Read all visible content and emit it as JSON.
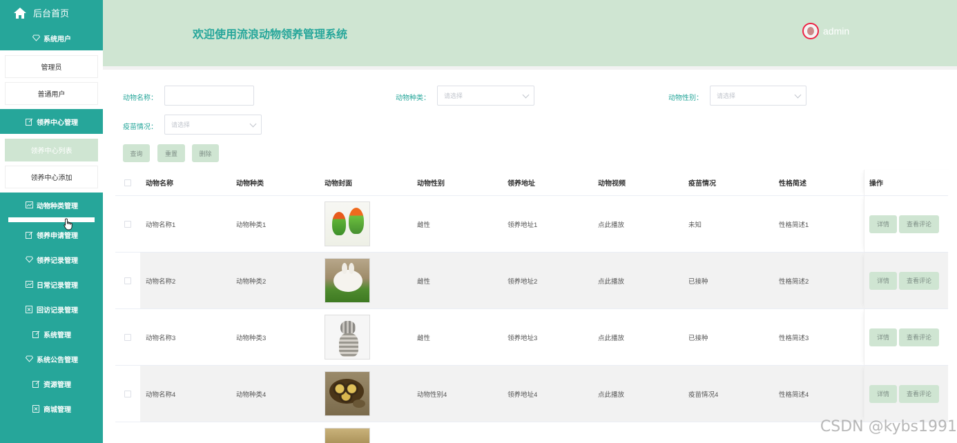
{
  "sidebar": {
    "home": "后台首页",
    "menus": [
      {
        "title": "系统用户",
        "icon": "diamond-icon",
        "subs": [
          "管理员",
          "普通用户"
        ]
      },
      {
        "title": "领养中心管理",
        "icon": "edit-icon",
        "subs": [
          "领养中心列表",
          "领养中心添加"
        ],
        "active_sub": 0
      },
      {
        "title": "动物种类管理",
        "icon": "chart-icon"
      },
      {
        "title": "领养申请管理",
        "icon": "edit-icon"
      },
      {
        "title": "领养记录管理",
        "icon": "diamond-icon"
      },
      {
        "title": "日常记录管理",
        "icon": "chart-icon"
      },
      {
        "title": "回访记录管理",
        "icon": "close-box-icon"
      },
      {
        "title": "系统管理",
        "icon": "edit-icon"
      },
      {
        "title": "系统公告管理",
        "icon": "diamond-icon"
      },
      {
        "title": "资源管理",
        "icon": "edit-icon"
      },
      {
        "title": "商城管理",
        "icon": "close-box-icon"
      }
    ]
  },
  "header": {
    "title": "欢迎使用流浪动物领养管理系统",
    "user": "admin"
  },
  "filters": {
    "name_label": "动物名称：",
    "type_label": "动物种类：",
    "type_placeholder": "请选择",
    "sex_label": "动物性别：",
    "sex_placeholder": "请选择",
    "vaccine_label": "疫苗情况：",
    "vaccine_placeholder": "请选择",
    "buttons": {
      "query": "查询",
      "reset": "重置",
      "delete": "删除"
    }
  },
  "table": {
    "columns": [
      "动物名称",
      "动物种类",
      "动物封面",
      "动物性别",
      "领养地址",
      "动物视频",
      "疫苗情况",
      "性格简述",
      "操作"
    ],
    "rows": [
      {
        "name": "动物名称1",
        "type": "动物种类1",
        "image": "parrot",
        "sex": "雌性",
        "address": "领养地址1",
        "video": "点此播放",
        "vaccine": "未知",
        "desc": "性格简述1"
      },
      {
        "name": "动物名称2",
        "type": "动物种类2",
        "image": "rabbit",
        "sex": "雌性",
        "address": "领养地址2",
        "video": "点此播放",
        "vaccine": "已接种",
        "desc": "性格简述2"
      },
      {
        "name": "动物名称3",
        "type": "动物种类3",
        "image": "cat",
        "sex": "雌性",
        "address": "领养地址3",
        "video": "点此播放",
        "vaccine": "已接种",
        "desc": "性格简述3"
      },
      {
        "name": "动物名称4",
        "type": "动物种类4",
        "image": "turtle",
        "sex": "动物性别4",
        "address": "领养地址4",
        "video": "点此播放",
        "vaccine": "疫苗情况4",
        "desc": "性格简述4"
      }
    ],
    "ops": {
      "detail": "详情",
      "review": "查看评论"
    }
  },
  "watermark": "CSDN @kybs1991",
  "colors": {
    "primary": "#26a69a",
    "header_bg": "#cfe5d2",
    "button_bg": "#cfe5d2"
  }
}
